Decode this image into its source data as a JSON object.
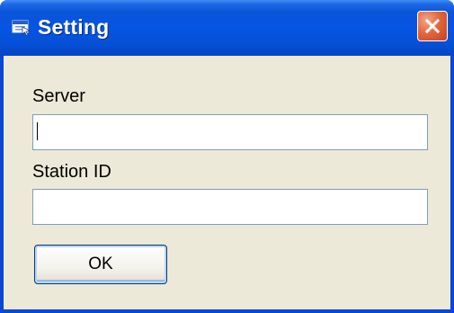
{
  "window": {
    "title": "Setting",
    "icons": {
      "app": "window-app-icon",
      "close": "close-icon"
    },
    "colors": {
      "titlebar": "#0554e3",
      "client_background": "#ece9d8",
      "close_button": "#e4673f",
      "input_border": "#7f9db9"
    }
  },
  "form": {
    "server": {
      "label": "Server",
      "value": ""
    },
    "station_id": {
      "label": "Station ID",
      "value": ""
    },
    "ok_label": "OK"
  }
}
